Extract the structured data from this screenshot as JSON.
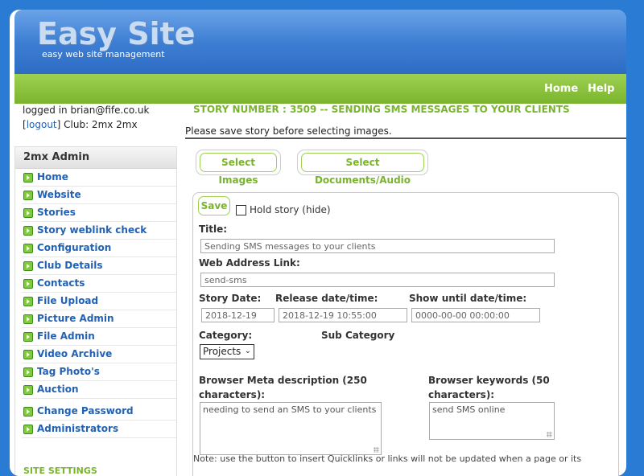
{
  "brand": {
    "logo": "Easy Site",
    "tagline": "easy web site management"
  },
  "nav": {
    "home": "Home",
    "help": "Help"
  },
  "user": {
    "logged_in_text": "logged in brian@fife.co.uk",
    "logout_label": "logout",
    "club_text": "Club: 2mx 2mx"
  },
  "sidebar": {
    "heading": "2mx Admin",
    "items": [
      {
        "label": "Home"
      },
      {
        "label": "Website"
      },
      {
        "label": "Stories"
      },
      {
        "label": "Story weblink check"
      },
      {
        "label": "Configuration"
      },
      {
        "label": "Club Details"
      },
      {
        "label": "Contacts"
      },
      {
        "label": "File Upload"
      },
      {
        "label": "Picture Admin"
      },
      {
        "label": "File Admin"
      },
      {
        "label": "Video Archive"
      },
      {
        "label": "Tag Photo's"
      },
      {
        "label": "Auction"
      }
    ],
    "items2": [
      {
        "label": "Change Password"
      },
      {
        "label": "Administrators"
      }
    ],
    "settings_heading": "SITE SETTINGS"
  },
  "story": {
    "title_bar": "STORY NUMBER : 3509 -- SENDING SMS MESSAGES TO YOUR CLIENTS",
    "save_note": "Please save story before selecting images.",
    "select_images": "Select Images",
    "select_docs": "Select Documents/Audio"
  },
  "form": {
    "save_label": "Save",
    "hold_label": "Hold story (hide)",
    "title_label": "Title:",
    "title_value": "Sending SMS messages to your clients",
    "web_label": "Web Address Link:",
    "web_value": "send-sms",
    "story_date_label": "Story Date:",
    "story_date_value": "2018-12-19",
    "release_label": "Release date/time:",
    "release_value": "2018-12-19 10:55:00",
    "show_until_label": "Show until date/time:",
    "show_until_value": "0000-00-00 00:00:00",
    "category_label": "Category:",
    "category_value": "Projects",
    "subcategory_label": "Sub Category",
    "meta_desc_label_1": "Browser Meta description (250",
    "meta_desc_label_2": "characters):",
    "meta_desc_value": "needing to send an SMS to your clients",
    "keywords_label_1": "Browser keywords (50",
    "keywords_label_2": "characters):",
    "keywords_value": "send SMS online"
  },
  "footer_note": "Note: use the button to insert Quicklinks or links will not be updated when a page or its"
}
